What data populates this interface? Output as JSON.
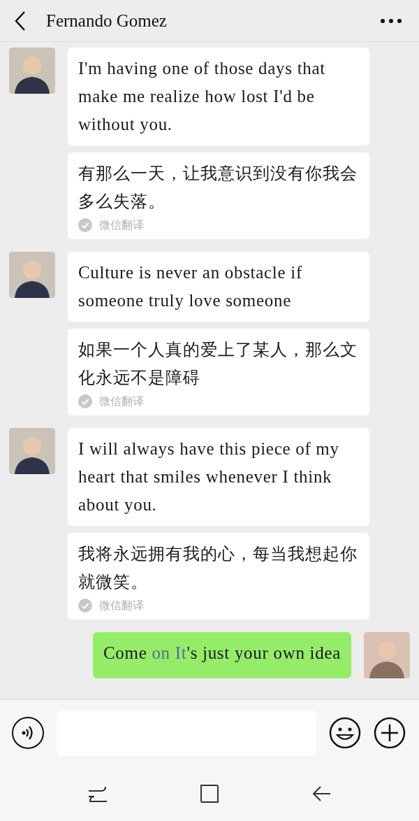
{
  "header": {
    "title": "Fernando Gomez"
  },
  "messages": [
    {
      "kind": "received",
      "text": "I'm having one of those days that make me realize how lost I'd be without you.",
      "translation": {
        "text": "有那么一天，让我意识到没有你我会多么失落。",
        "label": "微信翻译"
      }
    },
    {
      "kind": "received",
      "text": "Culture is never an obstacle if someone truly love someone",
      "translation": {
        "text": "如果一个人真的爱上了某人，那么文化永远不是障碍",
        "label": "微信翻译"
      }
    },
    {
      "kind": "received",
      "text": "I will always have this piece of my heart that smiles whenever I think about you.",
      "translation": {
        "text": "我将永远拥有我的心，每当我想起你就微笑。",
        "label": "微信翻译"
      }
    },
    {
      "kind": "sent",
      "segments": [
        {
          "text": "Come ",
          "link": false
        },
        {
          "text": "on It",
          "link": true
        },
        {
          "text": "'s just your own idea",
          "link": false
        }
      ]
    }
  ]
}
